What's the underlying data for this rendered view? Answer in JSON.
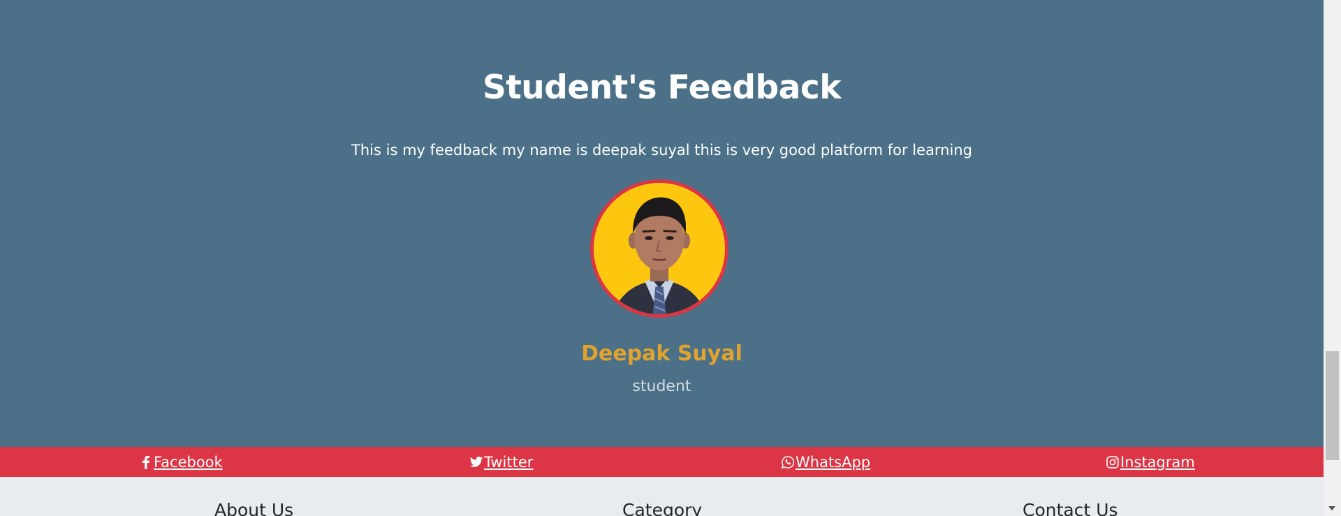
{
  "feedback": {
    "title": "Student's Feedback",
    "text": "This is my feedback my name is deepak suyal this is very good platform for learning",
    "student": {
      "name": "Deepak Suyal",
      "role": "student"
    }
  },
  "social": {
    "facebook": {
      "label": "Facebook",
      "icon": "facebook-icon"
    },
    "twitter": {
      "label": "Twitter",
      "icon": "twitter-icon"
    },
    "whatsapp": {
      "label": "WhatsApp",
      "icon": "whatsapp-icon"
    },
    "instagram": {
      "label": "Instagram",
      "icon": "instagram-icon"
    }
  },
  "footer": {
    "about": "About Us",
    "category": "Category",
    "contact": "Contact Us"
  },
  "colors": {
    "feedback_bg": "#4b7088",
    "accent_red": "#dc3545",
    "name_gold": "#e0a32e",
    "footer_bg": "#e9ecef"
  }
}
